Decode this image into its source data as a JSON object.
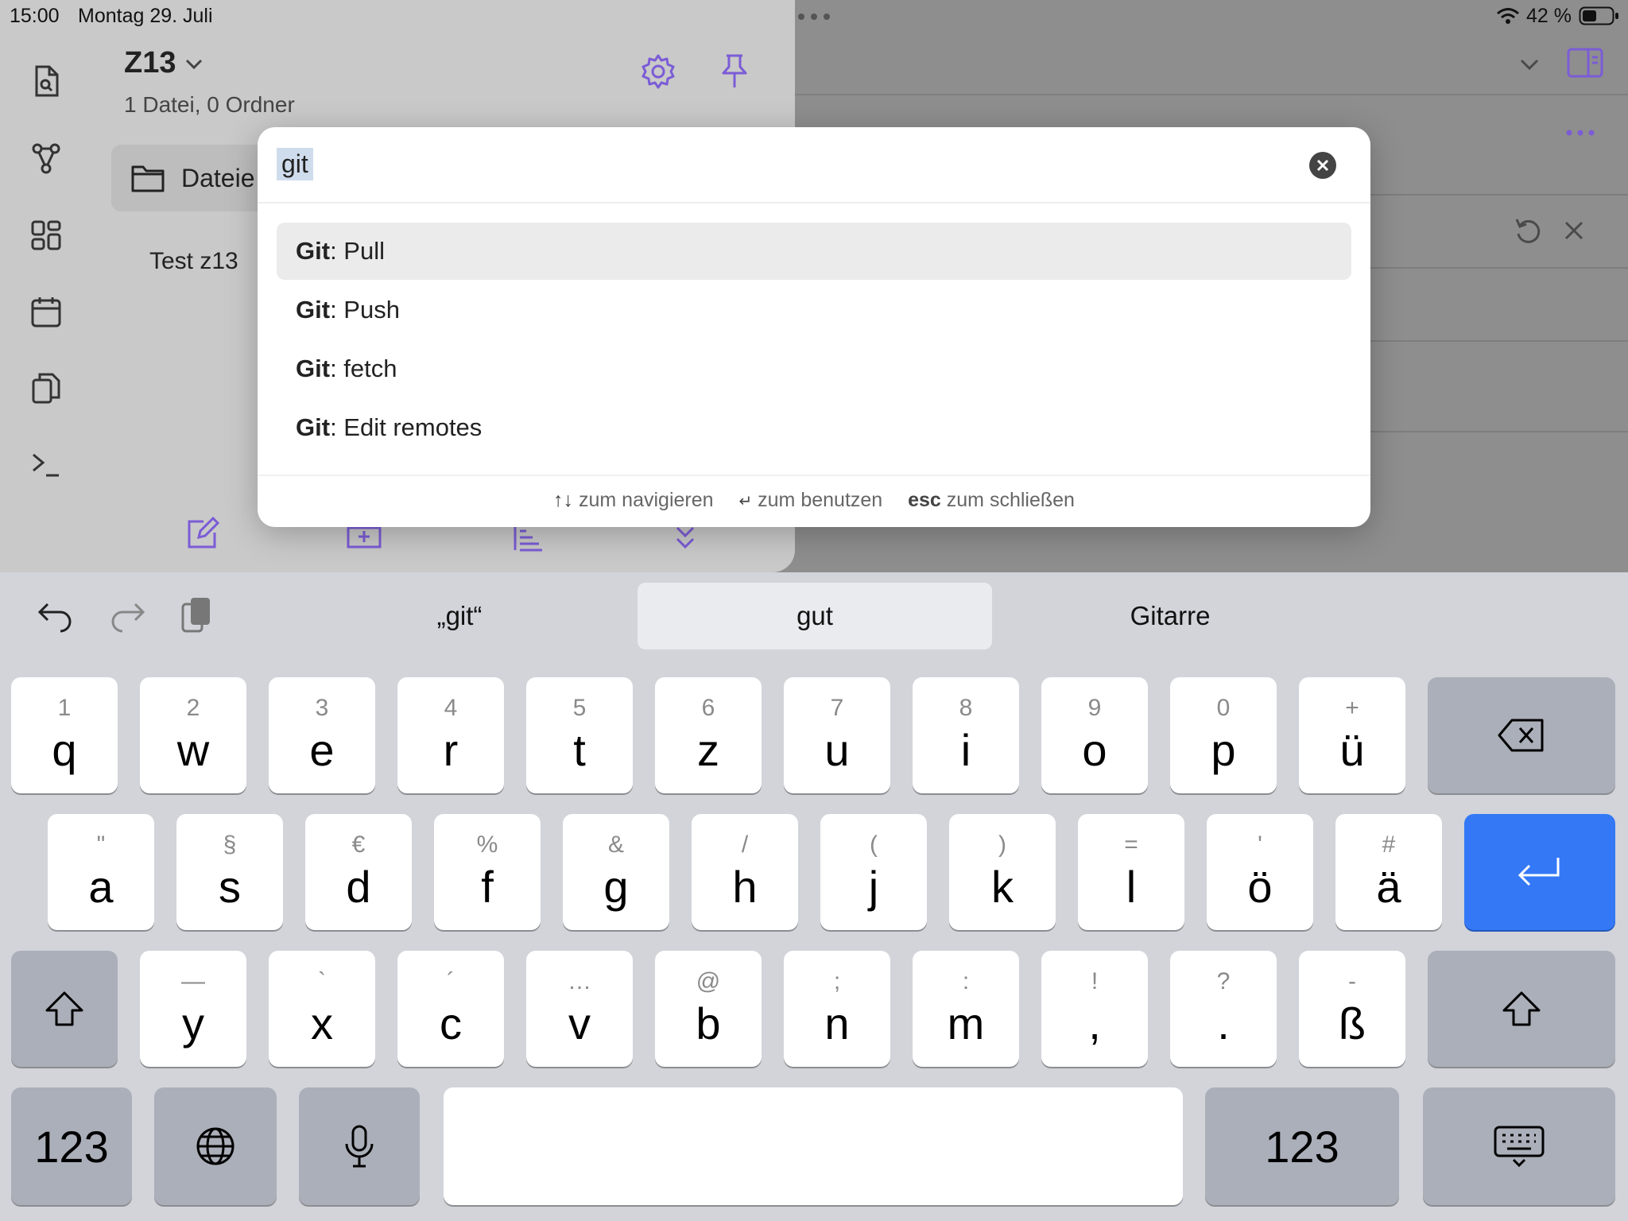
{
  "status": {
    "time": "15:00",
    "date": "Montag 29. Juli",
    "battery": "42 %"
  },
  "colors": {
    "accent": "#7b5cd6",
    "return_key": "#3478f6"
  },
  "vault": {
    "name": "Z13",
    "subtitle": "1 Datei, 0 Ordner",
    "files_tab": "Dateie",
    "file_item": "Test z13"
  },
  "ribbon_icons": [
    "file-search-icon",
    "graph-icon",
    "dashboard-icon",
    "calendar-icon",
    "copy-icon",
    "terminal-icon"
  ],
  "palette": {
    "query": "git",
    "results": [
      {
        "prefix": "Git",
        "rest": ": Pull"
      },
      {
        "prefix": "Git",
        "rest": ": Push"
      },
      {
        "prefix": "Git",
        "rest": ": fetch"
      },
      {
        "prefix": "Git",
        "rest": ": Edit remotes"
      }
    ],
    "hints": {
      "nav_keys": "↑↓",
      "nav": "zum navigieren",
      "use_key": "↵",
      "use": "zum benutzen",
      "esc_key": "esc",
      "esc": "zum schließen"
    }
  },
  "keyboard": {
    "predictions": [
      "„git“",
      "gut",
      "Gitarre"
    ],
    "row1": [
      [
        "1",
        "q"
      ],
      [
        "2",
        "w"
      ],
      [
        "3",
        "e"
      ],
      [
        "4",
        "r"
      ],
      [
        "5",
        "t"
      ],
      [
        "6",
        "z"
      ],
      [
        "7",
        "u"
      ],
      [
        "8",
        "i"
      ],
      [
        "9",
        "o"
      ],
      [
        "0",
        "p"
      ],
      [
        "+",
        "ü"
      ]
    ],
    "row2": [
      [
        "\"",
        "a"
      ],
      [
        "§",
        "s"
      ],
      [
        "€",
        "d"
      ],
      [
        "%",
        "f"
      ],
      [
        "&",
        "g"
      ],
      [
        "/",
        "h"
      ],
      [
        "(",
        "j"
      ],
      [
        ")",
        "k"
      ],
      [
        "=",
        "l"
      ],
      [
        "'",
        "ö"
      ],
      [
        "#",
        "ä"
      ]
    ],
    "row3": [
      [
        "—",
        "y"
      ],
      [
        "`",
        "x"
      ],
      [
        "´",
        "c"
      ],
      [
        "…",
        "v"
      ],
      [
        "@",
        "b"
      ],
      [
        ";",
        "n"
      ],
      [
        ":",
        "m"
      ],
      [
        "!",
        ","
      ],
      [
        "?",
        "."
      ],
      [
        "-",
        "ß"
      ]
    ],
    "num_label": "123"
  }
}
